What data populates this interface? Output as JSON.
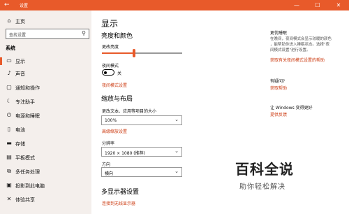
{
  "titlebar": {
    "title": "设置",
    "back_icon": "←",
    "minimize": "—",
    "maximize": "☐",
    "close": "✕"
  },
  "sidebar": {
    "home": "主页",
    "search_placeholder": "查找设置",
    "section": "系统",
    "items": [
      {
        "icon": "▭",
        "label": "显示"
      },
      {
        "icon": "♪",
        "label": "声音"
      },
      {
        "icon": "▢",
        "label": "通知和操作"
      },
      {
        "icon": "☾",
        "label": "专注助手"
      },
      {
        "icon": "⏻",
        "label": "电源和睡眠"
      },
      {
        "icon": "▯",
        "label": "电池"
      },
      {
        "icon": "▬",
        "label": "存储"
      },
      {
        "icon": "▤",
        "label": "平板模式"
      },
      {
        "icon": "⧉",
        "label": "多任务处理"
      },
      {
        "icon": "▣",
        "label": "投影到此电脑"
      },
      {
        "icon": "✕",
        "label": "体验共享"
      }
    ]
  },
  "main": {
    "title": "显示",
    "brightness_heading": "亮度和颜色",
    "brightness_label": "更改亮度",
    "brightness_level": 0.4,
    "night_mode_label": "夜间模式",
    "night_mode_state": "关",
    "night_mode_link": "夜间模式设置",
    "scale_heading": "缩放与布局",
    "scale_label": "更改文本、应用等项目的大小",
    "scale_value": "100%",
    "advanced_scale_link": "高级缩放设置",
    "resolution_label": "分辨率",
    "resolution_value": "1920 × 1080 (推荐)",
    "orientation_label": "方向",
    "orientation_value": "横向",
    "multi_heading": "多显示器设置",
    "wireless_link": "连接到无线显示器"
  },
  "right": {
    "sleep_heading": "更优睡眠",
    "sleep_text": [
      "在晚间，夜间模式会显示较暖的颜色",
      "，能帮助你进入睡眠状态。选择\"夜",
      "间模式设置\"进行设置。"
    ],
    "sleep_link": "获取有关夜间模式设置的帮助",
    "question_heading": "有疑问?",
    "question_link": "获取帮助",
    "improve_heading": "让 Windows 变得更好",
    "improve_link": "提供反馈"
  },
  "watermark": {
    "big": "百科全说",
    "small": "助你轻松解决"
  },
  "colors": {
    "accent": "#e85a2a",
    "link": "#cc3a10",
    "sidebar_bg": "#f4efec"
  }
}
